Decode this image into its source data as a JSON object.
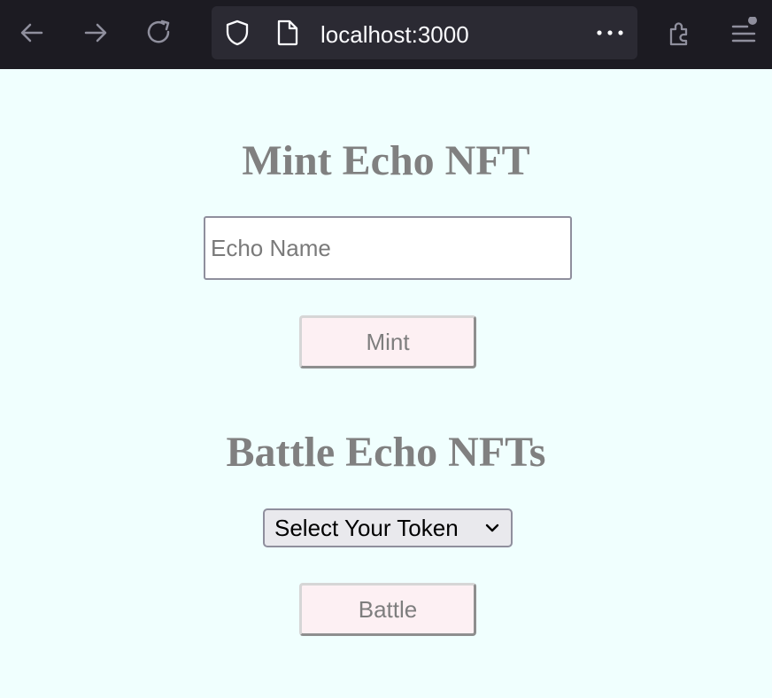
{
  "browser": {
    "url": "localhost:3000",
    "icons": {
      "back": "arrow-left-icon",
      "forward": "arrow-right-icon",
      "reload": "reload-icon",
      "shield": "shield-icon",
      "page": "page-icon",
      "more": "more-icon",
      "extensions": "puzzle-icon",
      "menu": "hamburger-menu-icon"
    }
  },
  "mint": {
    "heading": "Mint Echo NFT",
    "input_placeholder": "Echo Name",
    "input_value": "",
    "button_label": "Mint"
  },
  "battle": {
    "heading": "Battle Echo NFTs",
    "select_value": "Select Your Token",
    "button_label": "Battle"
  },
  "colors": {
    "page_background": "#f0fffe",
    "heading": "#808080",
    "button_background": "#fdf0f3",
    "toolbar_background": "#1c1b22"
  }
}
